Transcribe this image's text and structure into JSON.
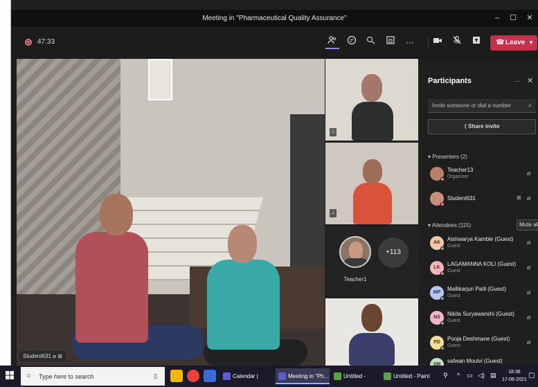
{
  "window": {
    "title": "Meeting in \"Pharmaceutical Quality Assurance\"",
    "minimize": "–",
    "maximize": "☐",
    "close": "✕"
  },
  "toolbar": {
    "timer": "47:33",
    "leave_label": "Leave",
    "icons": [
      "people-icon",
      "chat-icon",
      "reactions-icon",
      "breakout-icon",
      "more-icon",
      "camera-icon",
      "mic-off-icon",
      "share-icon"
    ]
  },
  "stage": {
    "name_tag": "Student631"
  },
  "tiles": {
    "teacher_name": "Teacher1",
    "more_count": "+113"
  },
  "participants": {
    "title": "Participants",
    "more": "···",
    "close": "✕",
    "invite_placeholder": "Invite someone or dial a number",
    "share_invite": "Share invite",
    "presenters_label": "Presenters (2)",
    "presenters": [
      {
        "name": "Teacher13",
        "sub": "Organizer"
      },
      {
        "name": "Student631",
        "sub": ""
      }
    ],
    "attendees_label": "Attendees (115)",
    "mute_all": "Mute all",
    "attendees": [
      {
        "initials": "AK",
        "name": "Aishwarya Kamble (Guest)",
        "sub": "Guest",
        "color": "#f3c6a8"
      },
      {
        "initials": "LK",
        "name": "LAGAMANNA KOLI (Guest)",
        "sub": "Guest",
        "color": "#f5b5b8"
      },
      {
        "initials": "MP",
        "name": "Mallikarjun Patil (Guest)",
        "sub": "Guest",
        "color": "#b8c7f1"
      },
      {
        "initials": "NS",
        "name": "Nikita Suryawanshi (Guest)",
        "sub": "Guest",
        "color": "#f3b7c9"
      },
      {
        "initials": "PD",
        "name": "Pooja Deshmane (Guest)",
        "sub": "Guest",
        "color": "#f1df9a"
      },
      {
        "initials": "SM",
        "name": "safwan Moulvi (Guest)",
        "sub": "",
        "color": "#bfe3c0"
      }
    ]
  },
  "taskbar": {
    "search_placeholder": "Type here to search",
    "tasks": [
      {
        "label": "Calendar | Micr..."
      },
      {
        "label": "Meeting in \"Ph..."
      },
      {
        "label": "Untitled - Paint"
      },
      {
        "label": "Untitled - Paint"
      }
    ],
    "time": "18:38",
    "date": "17-06-2021"
  },
  "colors": {
    "accent": "#8b8cf1",
    "leave": "#c4314b",
    "background": "#1f1f1f"
  }
}
